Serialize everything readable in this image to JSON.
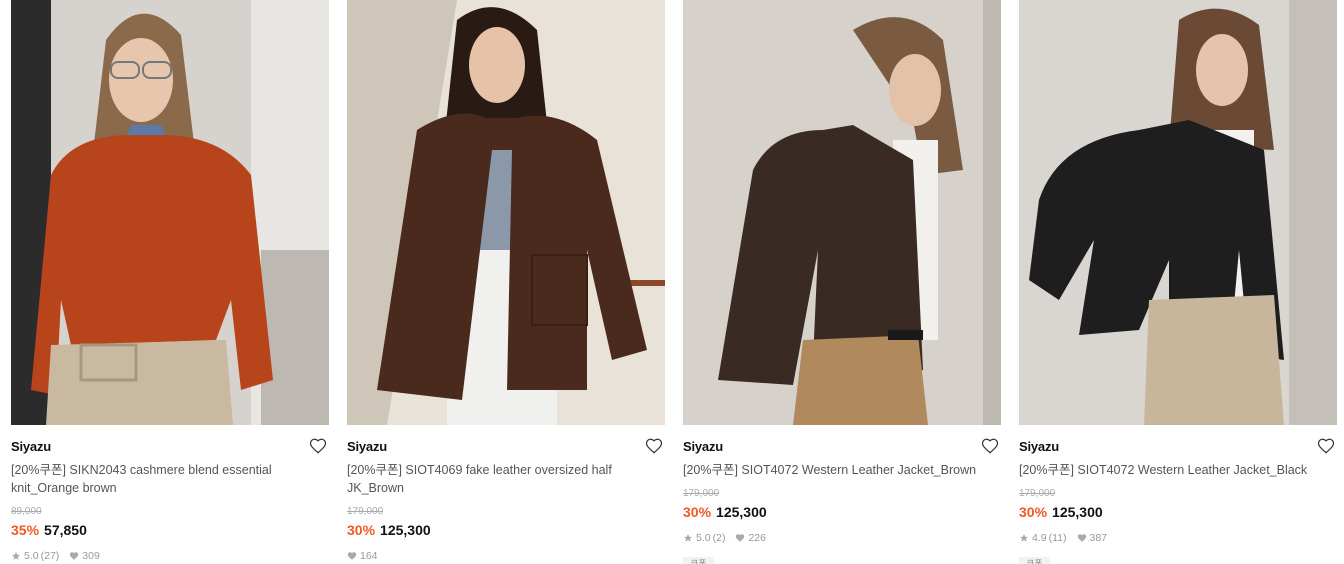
{
  "products": [
    {
      "brand": "Siyazu",
      "name": "[20%쿠폰] SIKN2043 cashmere blend essential knit_Orange brown",
      "original_price": "89,000",
      "discount": "35%",
      "price": "57,850",
      "rating": "5.0",
      "review_count": "(27)",
      "likes": "309",
      "photo_palette": {
        "bg": "#cfcac2",
        "wall": "#e9e6e1",
        "top": "#b8441b",
        "bottom": "#c9b9a0",
        "hair": "#8a6a4a",
        "skin": "#e6c7ae"
      }
    },
    {
      "brand": "Siyazu",
      "name": "[20%쿠폰] SIOT4069 fake leather oversized half JK_Brown",
      "original_price": "179,000",
      "discount": "30%",
      "price": "125,300",
      "rating": "",
      "review_count": "",
      "likes": "164",
      "photo_palette": {
        "bg": "#d9d2c8",
        "wall": "#efe9df",
        "top": "#4a2a1c",
        "bottom": "#f0f0ee",
        "hair": "#2a1a14",
        "skin": "#e6c3a8"
      }
    },
    {
      "brand": "Siyazu",
      "name": "[20%쿠폰] SIOT4072 Western Leather Jacket_Brown",
      "original_price": "179,000",
      "discount": "30%",
      "price": "125,300",
      "rating": "5.0",
      "review_count": "(2)",
      "likes": "226",
      "coupon_tag": "쿠폰",
      "photo_palette": {
        "bg": "#cbc6be",
        "wall": "#dcd8d1",
        "top": "#3a2a24",
        "bottom": "#b08a5c",
        "hair": "#7a5a40",
        "skin": "#e3c2aa"
      }
    },
    {
      "brand": "Siyazu",
      "name": "[20%쿠폰] SIOT4072 Western Leather Jacket_Black",
      "original_price": "179,000",
      "discount": "30%",
      "price": "125,300",
      "rating": "4.9",
      "review_count": "(11)",
      "likes": "387",
      "coupon_tag": "쿠폰",
      "photo_palette": {
        "bg": "#cfcbc5",
        "wall": "#e4e1dc",
        "top": "#1e1e1e",
        "bottom": "#c8b69c",
        "hair": "#6a4a34",
        "skin": "#e4c4ac"
      }
    }
  ],
  "icons": {
    "wishlist": "heart-outline-icon",
    "star": "star-icon",
    "like": "heart-filled-icon"
  },
  "colors": {
    "discount": "#f05a22",
    "muted": "#999999"
  }
}
